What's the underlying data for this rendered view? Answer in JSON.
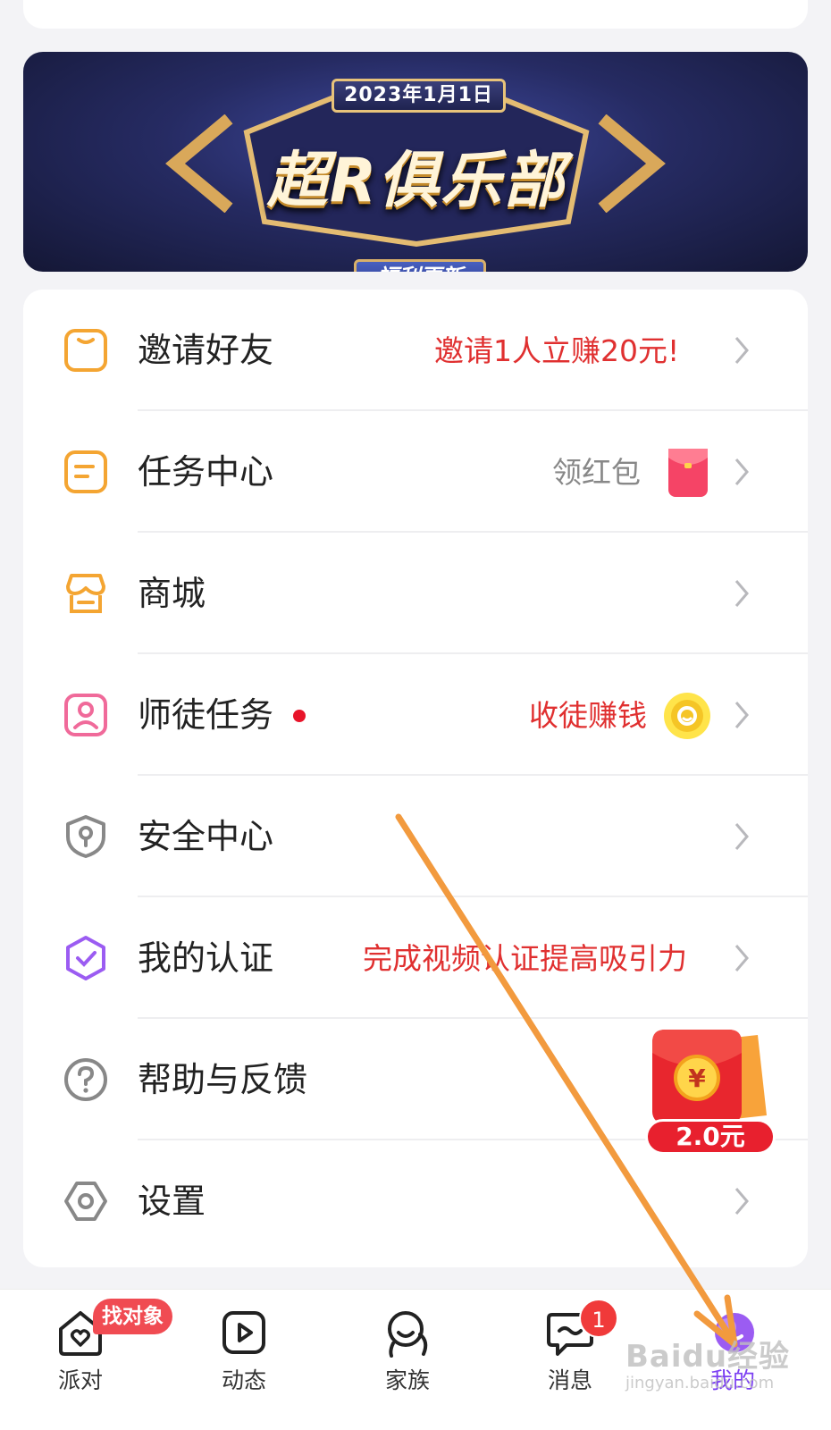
{
  "banner": {
    "date": "2023年1月1日",
    "title": "超R俱乐部",
    "subtitle": "福利更新"
  },
  "menu": {
    "items": [
      {
        "label": "邀请好友",
        "value": "邀请1人立赚20元!",
        "icon": "invite-bag-icon",
        "accent": "#f4a532",
        "value_color": "#e03030"
      },
      {
        "label": "任务中心",
        "value": "领红包",
        "icon": "task-list-icon",
        "accent": "#f4a532",
        "value_color": "#888888"
      },
      {
        "label": "商城",
        "value": "",
        "icon": "store-icon",
        "accent": "#f4a532"
      },
      {
        "label": "师徒任务",
        "value": "收徒赚钱",
        "icon": "mentor-person-icon",
        "accent": "#f06a9a",
        "value_color": "#e03030"
      },
      {
        "label": "安全中心",
        "value": "",
        "icon": "shield-key-icon",
        "accent": "#888888"
      },
      {
        "label": "我的认证",
        "value": "完成视频认证提高吸引力",
        "icon": "verified-badge-icon",
        "accent": "#9b5cf2",
        "value_color": "#e03030"
      },
      {
        "label": "帮助与反馈",
        "value": "",
        "icon": "help-question-icon",
        "accent": "#888888"
      },
      {
        "label": "设置",
        "value": "",
        "icon": "settings-hexagon-icon",
        "accent": "#888888"
      }
    ]
  },
  "floating_redpacket": {
    "amount": "2.0元",
    "symbol": "¥"
  },
  "tabbar": {
    "tabs": [
      {
        "label": "派对",
        "icon": "party-house-heart-icon",
        "badge": "找对象"
      },
      {
        "label": "动态",
        "icon": "video-play-icon"
      },
      {
        "label": "家族",
        "icon": "family-people-icon"
      },
      {
        "label": "消息",
        "icon": "message-bubble-icon",
        "badge": "1"
      },
      {
        "label": "我的",
        "icon": "profile-face-icon",
        "active": true
      }
    ],
    "active_color": "#7b3ff2"
  },
  "watermark": {
    "line1": "Baidu经验",
    "line2": "jingyan.baidu.com"
  }
}
